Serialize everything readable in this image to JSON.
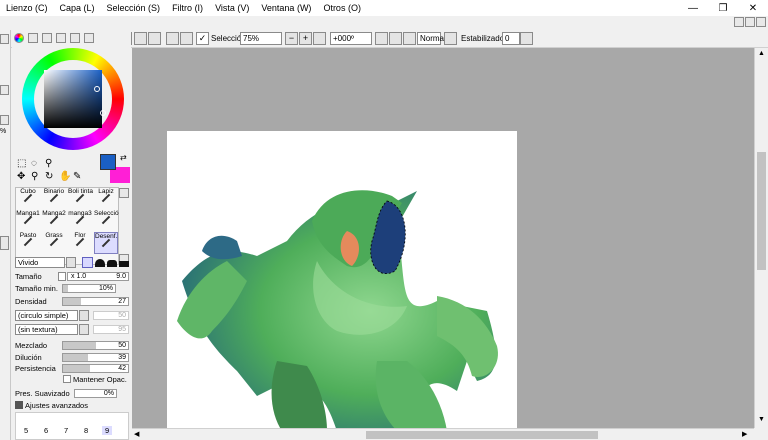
{
  "menubar": {
    "items": [
      "Lienzo (C)",
      "Capa (L)",
      "Selección (S)",
      "Filtro (I)",
      "Vista (V)",
      "Ventana (W)",
      "Otros (O)"
    ]
  },
  "toolbar": {
    "selection_label": "Selección",
    "zoom": "75%",
    "rotation": "+000º",
    "mode": "Normal",
    "stabilizer_label": "Estabilizador",
    "stabilizer_value": "0"
  },
  "leftstrip": {
    "percent": "%"
  },
  "colors": {
    "primary": "#1a5fc4",
    "secondary": "#ff1fd6"
  },
  "brushes": [
    {
      "name": "Cubo"
    },
    {
      "name": "Binario"
    },
    {
      "name": "Boli tinta"
    },
    {
      "name": "Lapiz"
    },
    {
      "name": "Manga1"
    },
    {
      "name": "Manga2"
    },
    {
      "name": "manga3"
    },
    {
      "name": "Selecció"
    },
    {
      "name": "Pasto"
    },
    {
      "name": "Grass"
    },
    {
      "name": "Flor"
    },
    {
      "name": "Desenf."
    }
  ],
  "brush_settings": {
    "blend_mode": "Vivido",
    "size_label": "Tamaño",
    "size_multiplier": "x 1.0",
    "size_value": "9.0",
    "min_size_label": "Tamaño min.",
    "min_size_value": "10%",
    "density_label": "Densidad",
    "density_value": "27",
    "shape": "(circulo simple)",
    "shape_value": "50",
    "texture": "(sin textura)",
    "texture_value": "95",
    "blending_label": "Mezclado",
    "blending_value": "50",
    "dilution_label": "Dilución",
    "dilution_value": "39",
    "persistence_label": "Persistencia",
    "persistence_value": "42",
    "keep_opacity_label": "Mantener Opac.",
    "smoothing_label": "Pres. Suavizado",
    "smoothing_value": "0%",
    "advanced_label": "Ajustes avanzados"
  },
  "size_presets": [
    "5",
    "6",
    "7",
    "8",
    "9"
  ]
}
